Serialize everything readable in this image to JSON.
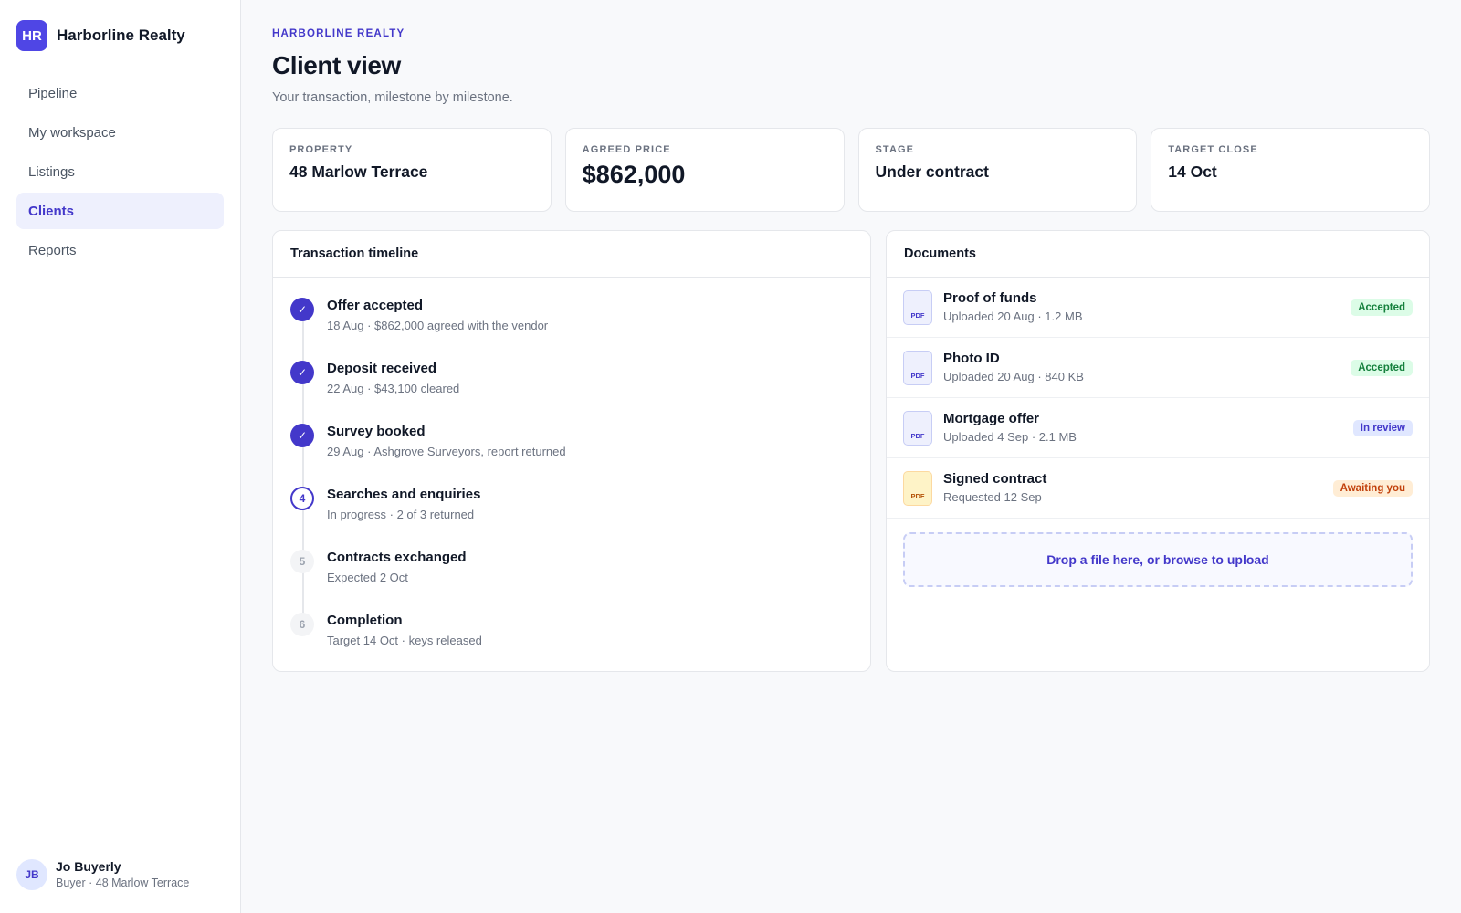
{
  "brand": {
    "initials": "HR",
    "name": "Harborline Realty"
  },
  "nav": {
    "items": [
      {
        "label": "Pipeline"
      },
      {
        "label": "My workspace"
      },
      {
        "label": "Listings"
      },
      {
        "label": "Clients",
        "active": true
      },
      {
        "label": "Reports"
      }
    ]
  },
  "user": {
    "initials": "JB",
    "name": "Jo Buyerly",
    "subtitle": "Buyer · 48 Marlow Terrace"
  },
  "header": {
    "eyebrow": "HARBORLINE REALTY",
    "title": "Client view",
    "subtitle": "Your transaction, milestone by milestone."
  },
  "stats": [
    {
      "label": "PROPERTY",
      "value": "48 Marlow Terrace"
    },
    {
      "label": "AGREED PRICE",
      "value": "$862,000"
    },
    {
      "label": "STAGE",
      "value": "Under contract"
    },
    {
      "label": "TARGET CLOSE",
      "value": "14 Oct"
    }
  ],
  "timeline": {
    "title": "Transaction timeline",
    "steps": [
      {
        "marker": "✓",
        "state": "done",
        "title": "Offer accepted",
        "desc": "18 Aug · $862,000 agreed with the vendor"
      },
      {
        "marker": "✓",
        "state": "done",
        "title": "Deposit received",
        "desc": "22 Aug · $43,100 cleared"
      },
      {
        "marker": "✓",
        "state": "done",
        "title": "Survey booked",
        "desc": "29 Aug · Ashgrove Surveyors, report returned"
      },
      {
        "marker": "4",
        "state": "current",
        "title": "Searches and enquiries",
        "desc": "In progress · 2 of 3 returned"
      },
      {
        "marker": "5",
        "state": "pending",
        "title": "Contracts exchanged",
        "desc": "Expected 2 Oct"
      },
      {
        "marker": "6",
        "state": "pending",
        "title": "Completion",
        "desc": "Target 14 Oct · keys released"
      }
    ]
  },
  "documents": {
    "title": "Documents",
    "items": [
      {
        "icon": "PDF",
        "title": "Proof of funds",
        "sub": "Uploaded 20 Aug · 1.2 MB",
        "status": "Accepted",
        "status_color": "#15803d"
      },
      {
        "icon": "PDF",
        "title": "Photo ID",
        "sub": "Uploaded 20 Aug · 840 KB",
        "status": "Accepted",
        "status_color": "#15803d"
      },
      {
        "icon": "PDF",
        "title": "Mortgage offer",
        "sub": "Uploaded 4 Sep · 2.1 MB",
        "status": "In review",
        "status_color": "#4338ca"
      },
      {
        "icon": "PDF",
        "title": "Signed contract",
        "sub": "Requested 12 Sep",
        "status": "Awaiting you",
        "status_color": "#c2410c"
      }
    ],
    "dropzone": "Drop a file here, or browse to upload"
  },
  "colors": {
    "accent": "#4338ca",
    "brand": "#4f46e5",
    "success": "#15803d",
    "warning": "#c2410c"
  }
}
